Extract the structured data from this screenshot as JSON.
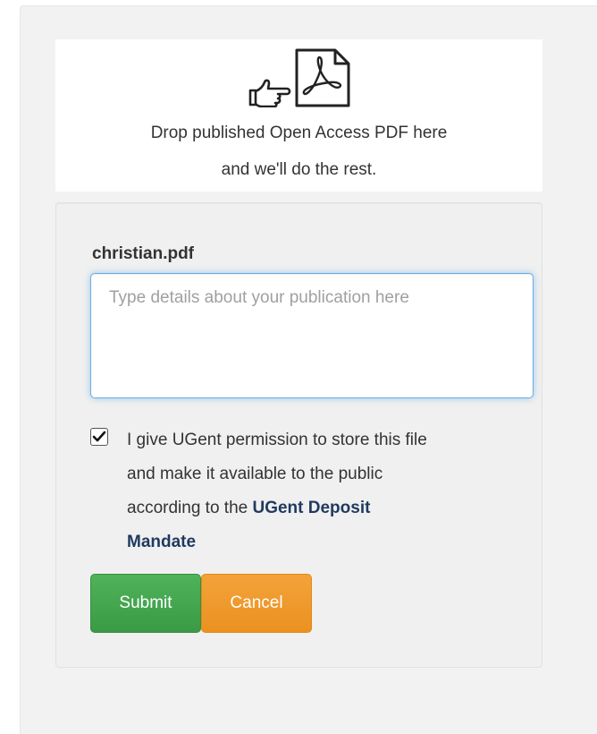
{
  "dropzone": {
    "line1": "Drop published Open Access PDF here",
    "line2": "and we'll do the rest.",
    "pointer_icon": "pointing-hand-icon",
    "pdf_icon": "pdf-file-icon"
  },
  "form": {
    "filename": "christian.pdf",
    "details": {
      "placeholder": "Type details about your publication here",
      "value": ""
    },
    "consent": {
      "checked": true,
      "line1": "I give UGent permission to store this file",
      "line2": "and make it available to the public",
      "line3_prefix": "according to the ",
      "link_part1": "UGent Deposit",
      "link_part2": "Mandate"
    },
    "submit_label": "Submit",
    "cancel_label": "Cancel"
  },
  "colors": {
    "submit": "#44a94f",
    "cancel": "#f09a2a",
    "focus_border": "#66afe9",
    "link": "#1f3a5f"
  }
}
